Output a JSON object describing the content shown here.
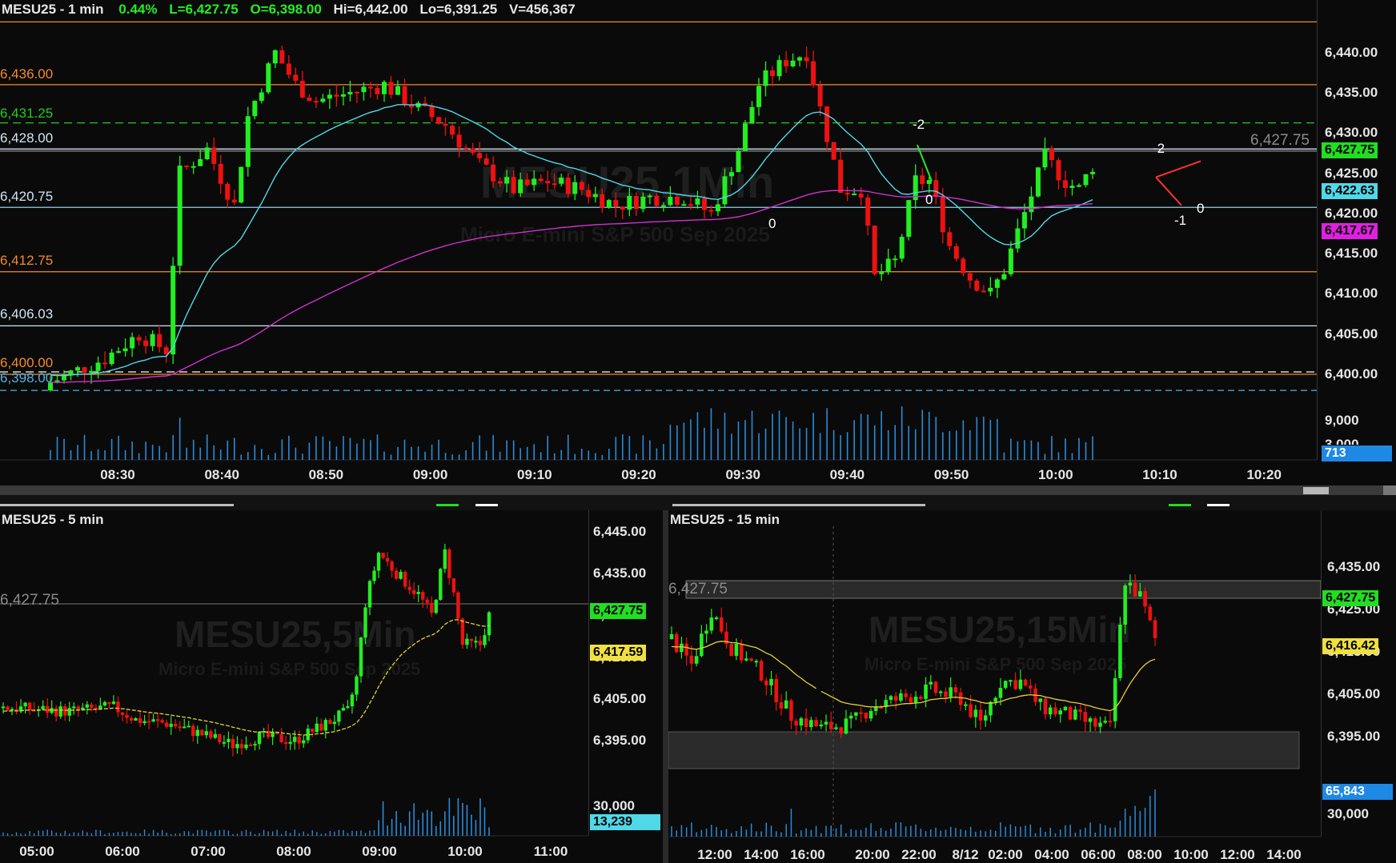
{
  "top": {
    "title": {
      "symbol": "MESU25 - 1 min",
      "change": "0.44%",
      "last": "L=6,427.75",
      "open": "O=6,398.00",
      "high": "Hi=6,442.00",
      "low": "Lo=6,391.25",
      "volume": "V=456,367"
    },
    "watermark": "MESU25,1Min",
    "watermark_sub": "Micro E-mini S&P 500 Sep 2025",
    "price_ticks": [
      "6,440.00",
      "6,435.00",
      "6,430.00",
      "6,425.00",
      "6,420.00",
      "6,415.00",
      "6,410.00",
      "6,405.00",
      "6,400.00"
    ],
    "volume_ticks": [
      "9,000",
      "3,000"
    ],
    "time_ticks": [
      "08:30",
      "08:40",
      "08:50",
      "09:00",
      "09:10",
      "09:20",
      "09:30",
      "09:40",
      "09:50",
      "10:00",
      "10:10",
      "10:20"
    ],
    "levels": [
      {
        "label": "6,436.00",
        "color": "#f28c28"
      },
      {
        "label": "6,431.25",
        "color": "#22cc22"
      },
      {
        "label": "6,428.00",
        "color": "#cfe6f5"
      },
      {
        "label": "6,420.75",
        "color": "#cfe6f5"
      },
      {
        "label": "6,412.75",
        "color": "#f28c28"
      },
      {
        "label": "6,406.03",
        "color": "#cfe6f5"
      },
      {
        "label": "6,400.00",
        "color": "#f28c28"
      },
      {
        "label": "6,398.00",
        "color": "#4fb3e8"
      }
    ],
    "last_price_label": "6,427.75",
    "tags": [
      {
        "text": "6,427.75",
        "bg": "#22dd22",
        "fg": "#000"
      },
      {
        "text": "6,422.63",
        "bg": "#4fd8e8",
        "fg": "#000"
      },
      {
        "text": "6,417.67",
        "bg": "#e020e0",
        "fg": "#000"
      },
      {
        "text": "713",
        "bg": "#1e88e5",
        "fg": "#fff"
      }
    ],
    "marker_labels": [
      "0",
      "-2",
      "0",
      "-2",
      "-1",
      "0"
    ]
  },
  "bl": {
    "title": "MESU25 - 5 min",
    "watermark": "MESU25,5Min",
    "watermark_sub": "Micro E-mini S&P 500 Sep 2025",
    "price_ticks": [
      "6,445.00",
      "6,435.00",
      "6,425.00",
      "6,415.00",
      "6,405.00",
      "6,395.00"
    ],
    "volume_ticks": [
      "30,000"
    ],
    "time_ticks": [
      "05:00",
      "06:00",
      "07:00",
      "08:00",
      "09:00",
      "10:00",
      "11:00"
    ],
    "last_price_label": "6,427.75",
    "tags": [
      {
        "text": "6,427.75",
        "bg": "#22dd22",
        "fg": "#000"
      },
      {
        "text": "6,417.59",
        "bg": "#f0e040",
        "fg": "#000"
      },
      {
        "text": "13,239",
        "bg": "#4fd8e8",
        "fg": "#000"
      }
    ]
  },
  "br": {
    "title": "MESU25 - 15 min",
    "watermark": "MESU25,15Min",
    "watermark_sub": "Micro E-mini S&P 500 Sep 2025",
    "price_ticks": [
      "6,435.00",
      "6,425.00",
      "6,415.00",
      "6,405.00",
      "6,395.00"
    ],
    "volume_ticks": [
      "30,000"
    ],
    "time_ticks": [
      "12:00",
      "14:00",
      "16:00",
      "20:00",
      "22:00",
      "8/12",
      "02:00",
      "04:00",
      "06:00",
      "08:00",
      "10:00",
      "12:00",
      "14:00"
    ],
    "last_price_label": "6,427.75",
    "tags": [
      {
        "text": "6,427.75",
        "bg": "#22dd22",
        "fg": "#000"
      },
      {
        "text": "6,416.42",
        "bg": "#f0e040",
        "fg": "#000"
      },
      {
        "text": "65,843",
        "bg": "#1e88e5",
        "fg": "#fff"
      }
    ]
  },
  "colors": {
    "up": "#22ee22",
    "down": "#ee1111",
    "ema_fast": "#4fd8e8",
    "ema_slow": "#d030d0",
    "ema_yellow": "#e8d030",
    "orange": "#f28c28"
  }
}
